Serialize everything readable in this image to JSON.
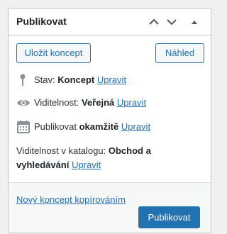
{
  "header": {
    "title": "Publikovat",
    "move_up_icon": "chevron-up-icon",
    "move_down_icon": "chevron-down-icon",
    "toggle_icon": "triangle-up-icon"
  },
  "buttons": {
    "save_draft": "Uložit koncept",
    "preview": "Náhled",
    "publish": "Publikovat"
  },
  "status": {
    "icon": "pin-icon",
    "label": "Stav:",
    "value": "Koncept",
    "edit": "Upravit"
  },
  "visibility": {
    "icon": "eye-icon",
    "label": "Viditelnost:",
    "value": "Veřejná",
    "edit": "Upravit"
  },
  "schedule": {
    "icon": "calendar-icon",
    "label": "Publikovat",
    "value": "okamžitě",
    "edit": "Upravit"
  },
  "catalog": {
    "label": "Viditelnost v katalogu:",
    "value": "Obchod a vyhledávání",
    "edit": "Upravit"
  },
  "actions": {
    "copy_link": "Nový koncept kopírováním"
  },
  "colors": {
    "accent": "#2271b1",
    "border": "#c3c4c7",
    "text": "#1d2327",
    "icon": "#8c8f94"
  }
}
